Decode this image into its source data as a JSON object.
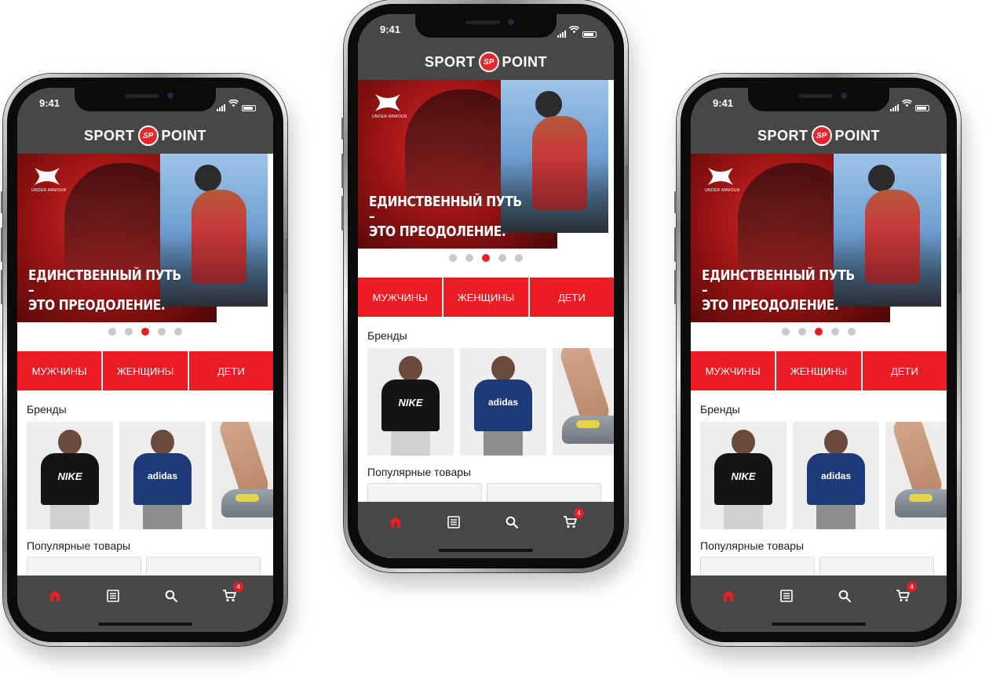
{
  "status": {
    "time": "9:41"
  },
  "app": {
    "logo_left": "SPORT",
    "logo_badge": "SP",
    "logo_right": "POINT"
  },
  "banner": {
    "brand": "UNDER ARMOUR",
    "headline_line1": "ЕДИНСТВЕННЫЙ ПУТЬ –",
    "headline_line2": "ЭТО ПРЕОДОЛЕНИЕ.",
    "slides_total": 5,
    "active_slide": 3
  },
  "categories": [
    "МУЖЧИНЫ",
    "ЖЕНЩИНЫ",
    "ДЕТИ"
  ],
  "sections": {
    "brands": "Бренды",
    "popular": "Популярные товары"
  },
  "brand_cards": [
    {
      "label": "NIKE"
    },
    {
      "label": "adidas"
    },
    {
      "label": ""
    }
  ],
  "tab_bar": {
    "items": [
      "home-icon",
      "catalog-icon",
      "search-icon",
      "cart-icon"
    ],
    "cart_count": "4"
  },
  "colors": {
    "accent": "#ec1c24",
    "chrome": "#474747",
    "inactive_icon": "#ffffff"
  }
}
